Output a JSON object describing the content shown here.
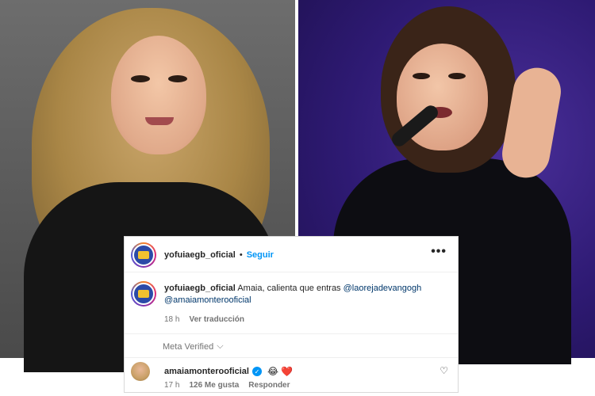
{
  "post": {
    "author": "yofuiaegb_oficial",
    "follow_label": "Seguir",
    "more_icon": "more-horizontal-icon"
  },
  "comment": {
    "author": "yofuiaegb_oficial",
    "text": "Amaia, calienta que entras",
    "mention_1": "@laorejadevangogh",
    "mention_2": "@amaiamonterooficial",
    "time": "18 h",
    "translate_label": "Ver traducción"
  },
  "meta_verified": {
    "label": "Meta Verified",
    "icon": "chevron-down-icon"
  },
  "reply": {
    "author": "amaiamonterooficial",
    "verified_icon": "verified-badge-icon",
    "emojis": [
      "😂",
      "❤️"
    ],
    "time": "17 h",
    "likes": "126 Me gusta",
    "reply_label": "Responder",
    "like_icon": "heart-outline-icon"
  },
  "colors": {
    "accent_blue": "#0095f6",
    "mention_link": "#00376b",
    "muted_text": "#737373"
  }
}
